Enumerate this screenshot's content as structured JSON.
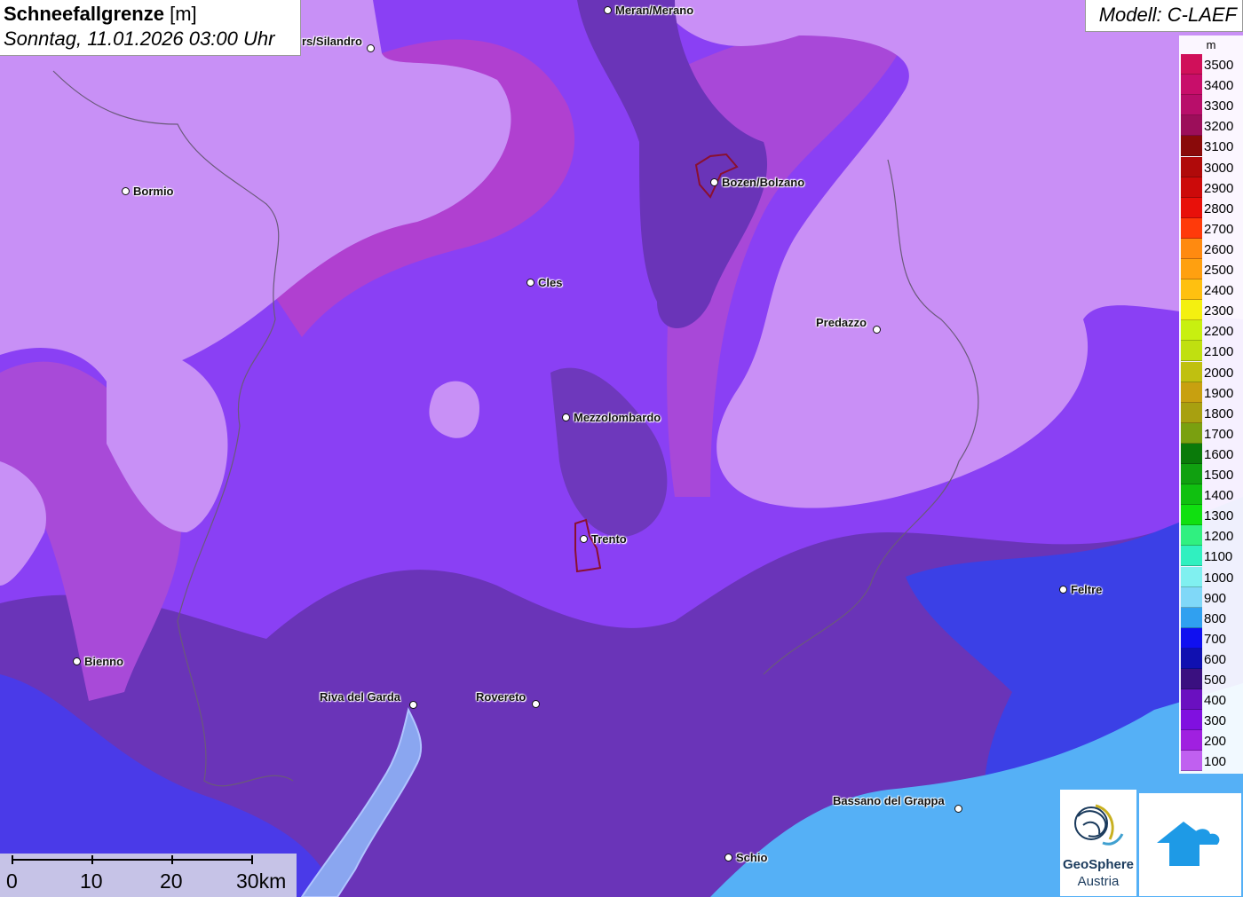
{
  "title": {
    "main_bold": "Schneefallgrenze",
    "main_unit": "[m]",
    "subtitle": "Sonntag, 11.01.2026 03:00 Uhr"
  },
  "model": {
    "label": "Modell: C-LAEF"
  },
  "legend": {
    "unit": "m",
    "entries": [
      {
        "value": "3500",
        "color": "#d0105a"
      },
      {
        "value": "3400",
        "color": "#c80e6a"
      },
      {
        "value": "3300",
        "color": "#b80e6a"
      },
      {
        "value": "3200",
        "color": "#9c0e5a"
      },
      {
        "value": "3100",
        "color": "#8a0a0a"
      },
      {
        "value": "3000",
        "color": "#b00a0a"
      },
      {
        "value": "2900",
        "color": "#cc0a0a"
      },
      {
        "value": "2800",
        "color": "#e8100a"
      },
      {
        "value": "2700",
        "color": "#ff3a0a"
      },
      {
        "value": "2600",
        "color": "#ff8a10"
      },
      {
        "value": "2500",
        "color": "#ffa010"
      },
      {
        "value": "2400",
        "color": "#ffc010"
      },
      {
        "value": "2300",
        "color": "#f4f010"
      },
      {
        "value": "2200",
        "color": "#c8f010"
      },
      {
        "value": "2100",
        "color": "#c0e010"
      },
      {
        "value": "2000",
        "color": "#c0c010"
      },
      {
        "value": "1900",
        "color": "#c8a010"
      },
      {
        "value": "1800",
        "color": "#a8a010"
      },
      {
        "value": "1700",
        "color": "#7aa010"
      },
      {
        "value": "1600",
        "color": "#0a7a0a"
      },
      {
        "value": "1500",
        "color": "#10a010"
      },
      {
        "value": "1400",
        "color": "#10c010"
      },
      {
        "value": "1300",
        "color": "#10e010"
      },
      {
        "value": "1200",
        "color": "#30f080"
      },
      {
        "value": "1100",
        "color": "#30f0c0"
      },
      {
        "value": "1000",
        "color": "#80f0f0"
      },
      {
        "value": "900",
        "color": "#80d8f8"
      },
      {
        "value": "800",
        "color": "#30a0f0"
      },
      {
        "value": "700",
        "color": "#1010f0"
      },
      {
        "value": "600",
        "color": "#1010b0"
      },
      {
        "value": "500",
        "color": "#3a1080"
      },
      {
        "value": "400",
        "color": "#6a10c0"
      },
      {
        "value": "300",
        "color": "#8010e0"
      },
      {
        "value": "200",
        "color": "#a020e0"
      },
      {
        "value": "100",
        "color": "#c060f0"
      }
    ]
  },
  "cities": [
    {
      "name": "Meran/Merano"
    },
    {
      "name": "rs/Silandro"
    },
    {
      "name": "Bormio"
    },
    {
      "name": "Bozen/Bolzano"
    },
    {
      "name": "Cles"
    },
    {
      "name": "Predazzo"
    },
    {
      "name": "Mezzolombardo"
    },
    {
      "name": "Trento"
    },
    {
      "name": "Feltre"
    },
    {
      "name": "Bienno"
    },
    {
      "name": "Riva del Garda"
    },
    {
      "name": "Rovereto"
    },
    {
      "name": "Bassano del Grappa"
    },
    {
      "name": "Schio"
    }
  ],
  "scale": {
    "labels": [
      "0",
      "10",
      "20",
      "30km"
    ]
  },
  "logo": {
    "line1": "GeoSphere",
    "line2": "Austria"
  },
  "icons": {
    "logo_left": "geosphere-logo-icon",
    "logo_right": "warning-cloud-icon"
  }
}
